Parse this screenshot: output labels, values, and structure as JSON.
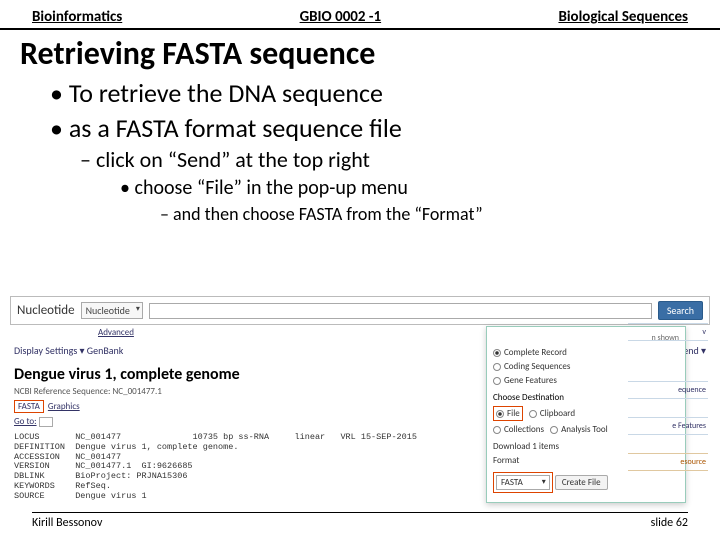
{
  "header": {
    "left": "Bioinformatics",
    "center": "GBIO 0002 -1",
    "right": "Biological Sequences"
  },
  "title": "Retrieving FASTA sequence",
  "bullets": {
    "b1": "To retrieve the DNA sequence",
    "b2": "as a FASTA format sequence file",
    "b3": "click on “Send” at the top right",
    "b4": "choose “File” in the pop-up menu",
    "b5": "and then choose FASTA from the “Format”"
  },
  "ncbi": {
    "db_label": "Nucleotide",
    "db_sel": "Nucleotide",
    "search_btn": "Search",
    "advanced": "Advanced",
    "display": "Display Settings ▾  GenBank",
    "send": "Send ▾",
    "rec_title": "Dengue virus 1, complete genome",
    "rec_sub": "NCBI Reference Sequence: NC_001477.1",
    "tab_fasta": "FASTA",
    "tab_graphics": "Graphics",
    "goto": "Go to:",
    "genbank": "LOCUS       NC_001477              10735 bp ss-RNA     linear   VRL 15-SEP-2015\nDEFINITION  Dengue virus 1, complete genome.\nACCESSION   NC_001477\nVERSION     NC_001477.1  GI:9626685\nDBLINK      BioProject: PRJNA15306\nKEYWORDS    RefSeq.\nSOURCE      Dengue virus 1"
  },
  "popup": {
    "hshown": "n shown",
    "opt1": "Complete Record",
    "opt2": "Coding Sequences",
    "opt3": "Gene Features",
    "dest_label": "Choose Destination",
    "d1": "File",
    "d2": "Clipboard",
    "d3": "Collections",
    "d4": "Analysis Tool",
    "dl": "Download 1 items",
    "fmt_label": "Format",
    "fmt_value": "FASTA",
    "create": "Create File"
  },
  "side": {
    "s1": "v",
    "s2": "equence",
    "s3": "e Features",
    "s4": "esource"
  },
  "footer": {
    "left": "Kirill Bessonov",
    "right": "slide 62"
  }
}
